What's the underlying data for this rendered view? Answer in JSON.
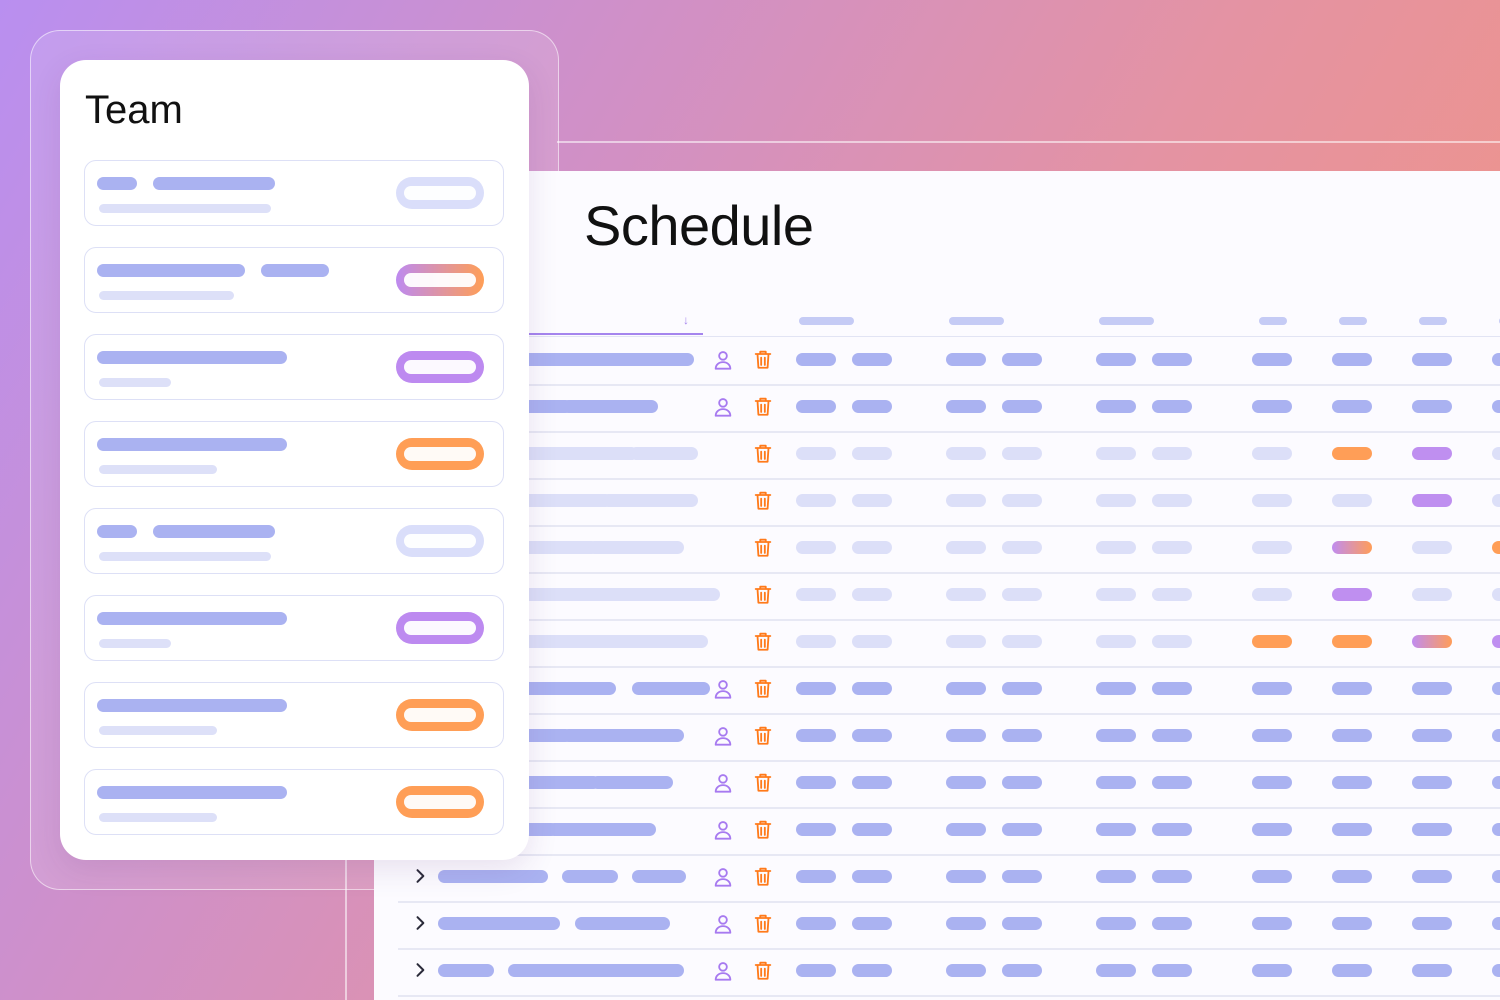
{
  "team": {
    "title": "Team",
    "cards": [
      {
        "status": "inactive"
      },
      {
        "status": "gradient"
      },
      {
        "status": "purple"
      },
      {
        "status": "orange"
      },
      {
        "status": "inactive"
      },
      {
        "status": "purple"
      },
      {
        "status": "orange"
      },
      {
        "status": "orange"
      }
    ]
  },
  "schedule": {
    "title": "Schedule",
    "rows": [
      {
        "state": "active",
        "cells": [
          "s",
          "s",
          "s",
          "s",
          "s",
          "s",
          "s"
        ]
      },
      {
        "state": "active",
        "cells": [
          "s",
          "s",
          "s",
          "s",
          "s",
          "s",
          "s"
        ]
      },
      {
        "state": "inactive",
        "cells": [
          "f",
          "f",
          "f",
          "f",
          "o",
          "p",
          "f"
        ]
      },
      {
        "state": "inactive",
        "cells": [
          "f",
          "f",
          "f",
          "f",
          "f",
          "p",
          "f"
        ]
      },
      {
        "state": "inactive",
        "cells": [
          "f",
          "f",
          "f",
          "f",
          "g",
          "f",
          "o"
        ]
      },
      {
        "state": "inactive",
        "cells": [
          "f",
          "f",
          "f",
          "f",
          "p",
          "f",
          "f"
        ]
      },
      {
        "state": "inactive",
        "cells": [
          "f",
          "f",
          "f",
          "o",
          "o",
          "g",
          "p"
        ]
      },
      {
        "state": "active",
        "cells": [
          "s",
          "s",
          "s",
          "s",
          "s",
          "s",
          "s"
        ]
      },
      {
        "state": "active",
        "cells": [
          "s",
          "s",
          "s",
          "s",
          "s",
          "s",
          "s"
        ]
      },
      {
        "state": "active",
        "cells": [
          "s",
          "s",
          "s",
          "s",
          "s",
          "s",
          "s"
        ]
      },
      {
        "state": "active",
        "cells": [
          "s",
          "s",
          "s",
          "s",
          "s",
          "s",
          "s"
        ]
      },
      {
        "state": "active",
        "cells": [
          "s",
          "s",
          "s",
          "s",
          "s",
          "s",
          "s"
        ]
      },
      {
        "state": "active",
        "cells": [
          "s",
          "s",
          "s",
          "s",
          "s",
          "s",
          "s"
        ]
      },
      {
        "state": "active",
        "cells": [
          "s",
          "s",
          "s",
          "s",
          "s",
          "s",
          "s"
        ]
      }
    ]
  },
  "colors": {
    "accent_purple": "#bf8ff0",
    "accent_orange": "#ff9e57",
    "placeholder": "#aab2f1",
    "placeholder_faint": "#dcdff8"
  },
  "icons": [
    "chevron-right-icon",
    "user-icon",
    "trash-icon",
    "sort-down-icon"
  ]
}
